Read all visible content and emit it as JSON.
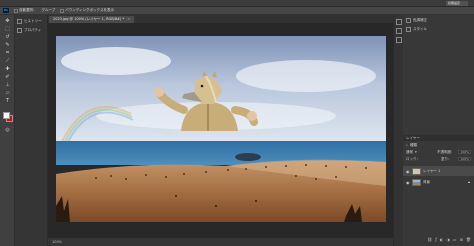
{
  "app": {
    "name": "Photoshop",
    "logo_text": "Ps",
    "workspace_label": "初期設定"
  },
  "options_bar": {
    "items": [
      "自動選択：",
      "グループ",
      "バウンディングボックスを表示"
    ]
  },
  "document_tab": {
    "label": "2023.jpg @ 100% (レイヤー 1, RGB/8#) *",
    "close": "×"
  },
  "left_dock": {
    "items": [
      "ヒストリー",
      "プロパティ"
    ]
  },
  "right_panels": {
    "top_items": [
      "色調補正",
      "スタイル"
    ],
    "layers_header": "レイヤー",
    "kind_label": "種類",
    "blend_mode": "通常",
    "opacity_label": "不透明度：",
    "opacity_value": "100%",
    "lock_label": "ロック：",
    "fill_label": "塗り：",
    "fill_value": "100%",
    "layers": [
      {
        "name": "レイヤー 1",
        "selected": true
      },
      {
        "name": "背景",
        "selected": false
      }
    ],
    "footer_icons": [
      "link-icon",
      "fx-icon",
      "mask-icon",
      "adjustment-icon",
      "folder-icon",
      "new-layer-icon",
      "trash-icon"
    ]
  },
  "status_bar": {
    "text": "100%"
  },
  "colors": {
    "foreground": "#ffffff",
    "background": "#d01010",
    "ui_dark": "#282828"
  }
}
